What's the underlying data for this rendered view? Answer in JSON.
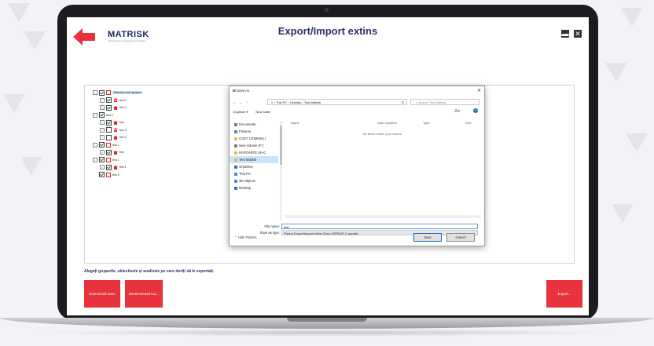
{
  "app": {
    "logo": "MATRISK",
    "logo_tagline": "Soluții pentru managementul riscului",
    "title": "Export/Import extins",
    "accent": "#e8333d",
    "title_color": "#2a2f6e"
  },
  "window_controls": {
    "minimize": "▬",
    "close": "✕"
  },
  "tree": [
    {
      "label": "Obiective nivel grupare",
      "level": 0,
      "expander": "−",
      "checked": true,
      "icon": "group-icon",
      "selected": true
    },
    {
      "label": "test 4",
      "level": 1,
      "expander": "+",
      "checked": true,
      "icon": "house-icon"
    },
    {
      "label": "test 3",
      "level": 1,
      "expander": "+",
      "checked": true,
      "icon": "house-icon"
    },
    {
      "label": "test 2",
      "level": 0,
      "expander": "−",
      "checked": true,
      "icon": "none"
    },
    {
      "label": "test",
      "level": 1,
      "expander": "+",
      "checked": true,
      "icon": "house-icon"
    },
    {
      "label": "test 3",
      "level": 1,
      "expander": "+",
      "checked": false,
      "icon": "house-icon"
    },
    {
      "label": "test 4",
      "level": 1,
      "expander": "+",
      "checked": false,
      "icon": "house-icon"
    },
    {
      "label": "test 1",
      "level": 0,
      "expander": "−",
      "checked": true,
      "icon": "group-icon"
    },
    {
      "label": "test",
      "level": 1,
      "expander": "+",
      "checked": true,
      "icon": "house-icon"
    },
    {
      "label": "test 1",
      "level": 0,
      "expander": "−",
      "checked": true,
      "icon": "group-icon"
    },
    {
      "label": "test 1",
      "level": 1,
      "expander": "+",
      "checked": true,
      "icon": "house-icon"
    },
    {
      "label": "test 5",
      "level": 0,
      "expander": "",
      "checked": true,
      "icon": "group-icon"
    }
  ],
  "dialog": {
    "title": "Save As",
    "nav": {
      "back": "←",
      "forward": "→",
      "up": "↑",
      "refresh": "↻"
    },
    "address": "› This PC  ›  Desktop  ›  Test Matrisk",
    "search_placeholder": "Search Test Matrisk",
    "toolbar": {
      "organize": "Organize ▾",
      "new_folder": "New folder"
    },
    "sidebar": [
      {
        "label": "Documents",
        "icon": "document-icon",
        "color": "#6d7f99"
      },
      {
        "label": "Pictures",
        "icon": "picture-icon",
        "color": "#5a86c2"
      },
      {
        "label": "COST CRIMINALI",
        "icon": "folder-icon",
        "color": "#e8b84a"
      },
      {
        "label": "New Volume (F:)",
        "icon": "drive-icon",
        "color": "#7a7a7a"
      },
      {
        "label": "RAPOARTE SH-C",
        "icon": "folder-icon",
        "color": "#e8b84a"
      },
      {
        "label": "Test Matrisk",
        "icon": "folder-icon",
        "color": "#e8b84a",
        "selected": true
      },
      {
        "label": "OneDrive",
        "icon": "cloud-icon",
        "color": "#1f6fd1"
      },
      {
        "label": "This PC",
        "icon": "pc-icon",
        "color": "#4a8ad4"
      },
      {
        "label": "3D Objects",
        "icon": "cube-icon",
        "color": "#4a8ad4"
      },
      {
        "label": "Desktop",
        "icon": "desktop-icon",
        "color": "#2a78d0"
      }
    ],
    "columns": {
      "name": "Name",
      "date": "Date modified",
      "type": "Type",
      "size": "Size"
    },
    "empty_message": "No items match your search.",
    "file_name_label": "File name:",
    "file_name_value": "test",
    "save_type_label": "Save as type:",
    "save_type_value": "Fișiere Export/Import extins Oneo GRPDAT (*.grpdat)",
    "hide_folders": "Hide Folders",
    "save_button": "Save",
    "cancel_button": "Cancel"
  },
  "hint": "Alegeți grupurile, obiectivele și analizele pe care doriți să le exportați.",
  "buttons": {
    "select_all": "Selectează toate",
    "deselect_all": "Deselectează toa...",
    "export": "Export..."
  }
}
